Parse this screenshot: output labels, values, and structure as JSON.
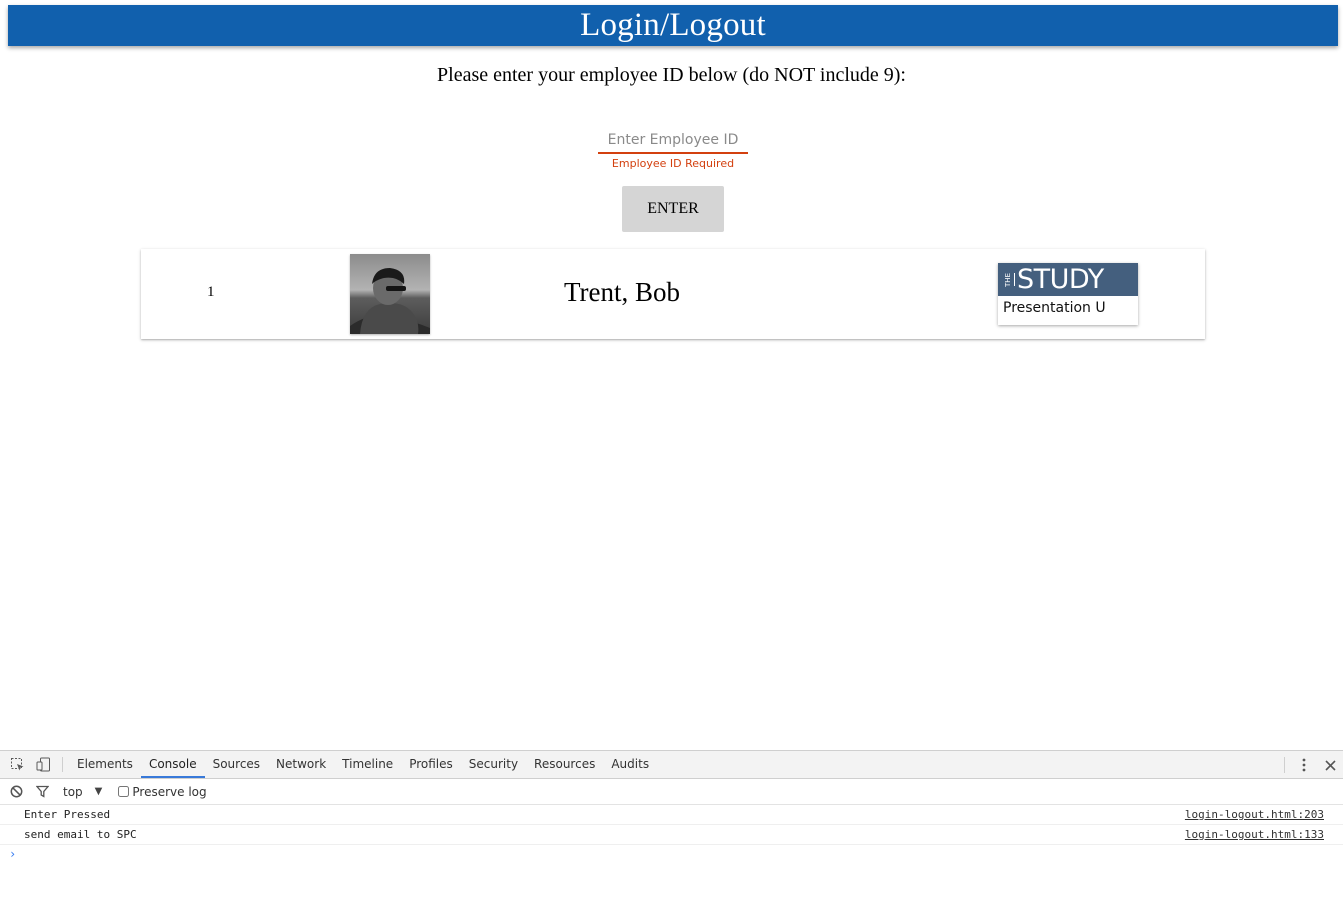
{
  "header": {
    "title": "Login/Logout"
  },
  "login": {
    "prompt": "Please enter your employee ID below (do NOT include 9):",
    "input_placeholder": "Enter Employee ID",
    "input_value": "",
    "error": "Employee ID Required",
    "enter_label": "ENTER"
  },
  "records": [
    {
      "number": "1",
      "name": "Trent, Bob",
      "brand": {
        "prefix": "THE",
        "title": "STUDY",
        "subtitle": "Presentation U"
      }
    }
  ],
  "devtools": {
    "tabs": [
      "Elements",
      "Console",
      "Sources",
      "Network",
      "Timeline",
      "Profiles",
      "Security",
      "Resources",
      "Audits"
    ],
    "active_tab": "Console",
    "context": "top",
    "preserve_log_label": "Preserve log",
    "preserve_log_checked": false,
    "messages": [
      {
        "text": "Enter Pressed",
        "source": "login-logout.html:203"
      },
      {
        "text": "send email to SPC",
        "source": "login-logout.html:133"
      }
    ],
    "prompt_symbol": "›"
  },
  "colors": {
    "header_bg": "#1160ad",
    "error": "#d3400f",
    "brand_banner": "#445f7e",
    "active_tab_underline": "#3879d9"
  }
}
